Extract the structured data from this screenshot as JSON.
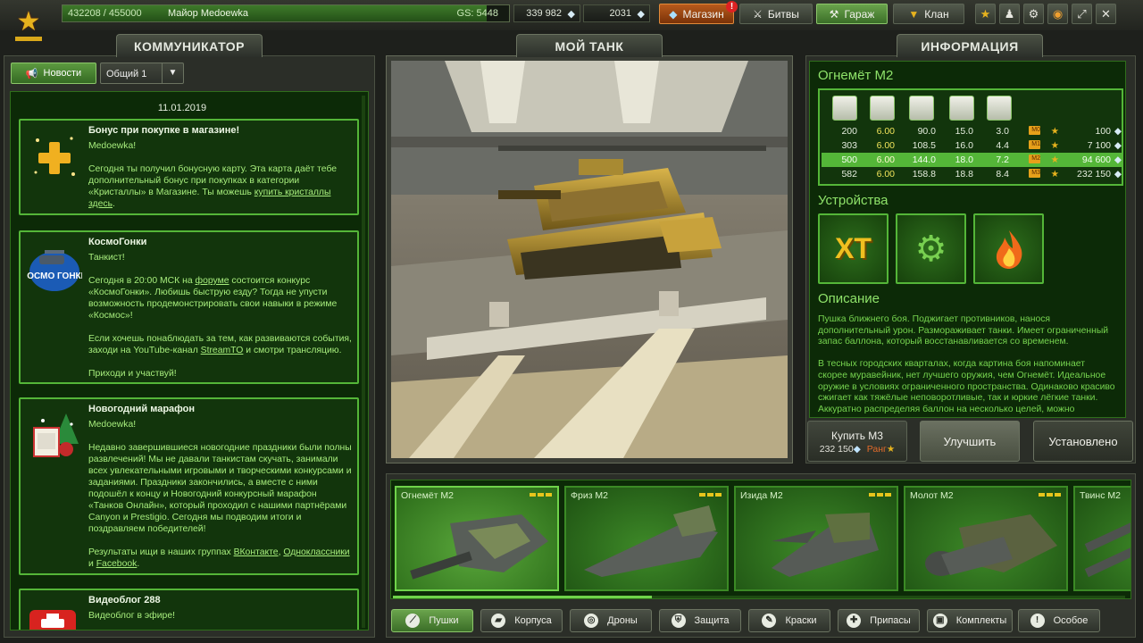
{
  "topbar": {
    "xp_text": "432208 / 455000",
    "xp_progress": 0.949,
    "rank_name": "Майор Medoewka",
    "gs": "GS: 5448",
    "crystals": "339 982",
    "premium": "2031",
    "shop_label": "Магазин",
    "shop_badge": "!",
    "battles_label": "Битвы",
    "garage_label": "Гараж",
    "clan_label": "Клан",
    "icons": [
      "star-icon",
      "missions-icon",
      "settings-icon",
      "sound-icon",
      "fullscreen-icon",
      "close-icon"
    ]
  },
  "communicator": {
    "title": "КОММУНИКАТОР",
    "news_button": "Новости",
    "channel": "Общий 1",
    "date": "11.01.2019",
    "news": [
      {
        "title": "Бонус при покупке в магазине!",
        "greeting": "Medoewka!",
        "text": "Сегодня ты получил бонусную карту. Эта карта даёт тебе дополнительный бонус при покупках в категории «Кристаллы» в Магазине. Ты можешь",
        "link": "купить кристаллы здесь",
        "tail": "."
      },
      {
        "title": "КосмоГонки",
        "greeting": "Танкист!",
        "icon_text": "КОСМО ГОНКИ",
        "text1": "Сегодня в 20:00 МСК на",
        "link1": "форуме",
        "text2": "состоится конкурс «КосмоГонки». Любишь быструю езду? Тогда не упусти возможность продемонстрировать свои навыки в режиме «Космос»!",
        "text3": "Если хочешь понаблюдать за тем, как развиваются события, заходи на YouTube-канал",
        "link2": "StreamTO",
        "text4": "и смотри трансляцию.",
        "text5": "Приходи и участвуй!"
      },
      {
        "title": "Новогодний марафон",
        "greeting": "Medoewka!",
        "text1": "Недавно завершившиеся новогодние праздники были полны развлечений! Мы не давали танкистам скучать, занимали всех увлекательными игровыми и творческими конкурсами и заданиями. Праздники закончились, а вместе с ними подошёл к концу и Новогодний конкурсный марафон «Танков Онлайн», который проходил с нашими партнёрами Canyon и Prestigio. Сегодня мы подводим итоги и поздравляем победителей!",
        "text2": "Результаты ищи в наших группах",
        "link1": "ВКонтакте",
        "link2": "Одноклассники",
        "and": "и",
        "link3": "Facebook",
        "tail": "."
      },
      {
        "title": "Видеоблог 288",
        "greeting": "Видеоблог в эфире!"
      }
    ]
  },
  "mytank": {
    "title": "МОЙ ТАНК"
  },
  "info": {
    "title": "ИНФОРМАЦИЯ",
    "item_name": "Огнемёт М2",
    "stat_icons": [
      "damage-icon",
      "reload-icon",
      "range-icon",
      "heat-icon",
      "impact-icon"
    ],
    "rows": [
      {
        "v": [
          "200",
          "6.00",
          "90.0",
          "15.0",
          "3.0"
        ],
        "mk": "M0",
        "price": "100"
      },
      {
        "v": [
          "303",
          "6.00",
          "108.5",
          "16.0",
          "4.4"
        ],
        "mk": "M1",
        "price": "7 100"
      },
      {
        "v": [
          "500",
          "6.00",
          "144.0",
          "18.0",
          "7.2"
        ],
        "mk": "M2",
        "price": "94 600"
      },
      {
        "v": [
          "582",
          "6.00",
          "158.8",
          "18.8",
          "8.4"
        ],
        "mk": "M3",
        "price": "232 150"
      }
    ],
    "selected_row": 2,
    "devices_title": "Устройства",
    "device_xt": "XT",
    "description_title": "Описание",
    "description": [
      "Пушка ближнего боя. Поджигает противников, нанося дополнительный урон. Размораживает танки. Имеет ограниченный запас баллона, который восстанавливается со временем.",
      "В тесных городских кварталах, когда картина боя напоминает скорее муравейник, нет лучшего оружия, чем Огнемёт. Идеальное оружие в условиях ограниченного пространства. Одинаково красиво сжигает как тяжёлые неповоротливые, так и юркие лёгкие танки. Аккуратно распределяя баллон на несколько целей, можно"
    ],
    "buy_label": "Купить М3",
    "buy_price": "232 150",
    "buy_rank": "Ранг",
    "upgrade_label": "Улучшить",
    "installed_label": "Установлено"
  },
  "carousel": {
    "items": [
      {
        "name": "Огнемёт М2",
        "bars": 3
      },
      {
        "name": "Фриз М2",
        "bars": 3
      },
      {
        "name": "Изида М2",
        "bars": 3
      },
      {
        "name": "Молот М2",
        "bars": 3
      },
      {
        "name": "Твинс М2",
        "bars": 0
      }
    ],
    "selected": 0
  },
  "bottom_tabs": [
    {
      "label": "Пушки",
      "icon": "turret-icon"
    },
    {
      "label": "Корпуса",
      "icon": "hull-icon"
    },
    {
      "label": "Дроны",
      "icon": "drone-icon"
    },
    {
      "label": "Защита",
      "icon": "shield-icon"
    },
    {
      "label": "Краски",
      "icon": "paint-icon"
    },
    {
      "label": "Припасы",
      "icon": "supplies-icon"
    },
    {
      "label": "Комплекты",
      "icon": "kit-icon"
    },
    {
      "label": "Особое",
      "icon": "special-icon"
    }
  ],
  "colors": {
    "accent_green": "#54b638",
    "text_green": "#a6ec7c",
    "title_green": "#8fe36a",
    "gold": "#e8c51c"
  }
}
